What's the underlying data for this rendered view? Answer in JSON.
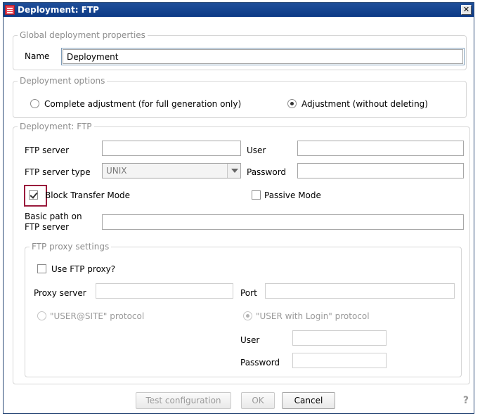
{
  "window": {
    "title": "Deployment: FTP",
    "close_label": "✕"
  },
  "global": {
    "legend": "Global deployment properties",
    "name_label": "Name",
    "name_value": "Deployment"
  },
  "options": {
    "legend": "Deployment options",
    "complete_label": "Complete adjustment (for full generation only)",
    "adjustment_label": "Adjustment (without deleting)",
    "selected": "adjustment"
  },
  "ftp": {
    "legend": "Deployment: FTP",
    "server_label": "FTP server",
    "server_value": "",
    "user_label": "User",
    "user_value": "",
    "type_label": "FTP server type",
    "type_value": "UNIX",
    "password_label": "Password",
    "password_value": "",
    "block_label": "Block Transfer Mode",
    "block_checked": true,
    "passive_label": "Passive Mode",
    "passive_checked": false,
    "path_label_1": "Basic path on",
    "path_label_2": "FTP server",
    "path_value": ""
  },
  "proxy": {
    "legend": "FTP proxy settings",
    "use_label": "Use FTP proxy?",
    "use_checked": false,
    "server_label": "Proxy server",
    "port_label": "Port",
    "site_protocol_label": "\"USER@SITE\" protocol",
    "login_protocol_label": "\"USER with Login\" protocol",
    "user_label": "User",
    "password_label": "Password"
  },
  "buttons": {
    "test_label": "Test configuration",
    "ok_label": "OK",
    "cancel_label": "Cancel",
    "help_label": "?"
  }
}
